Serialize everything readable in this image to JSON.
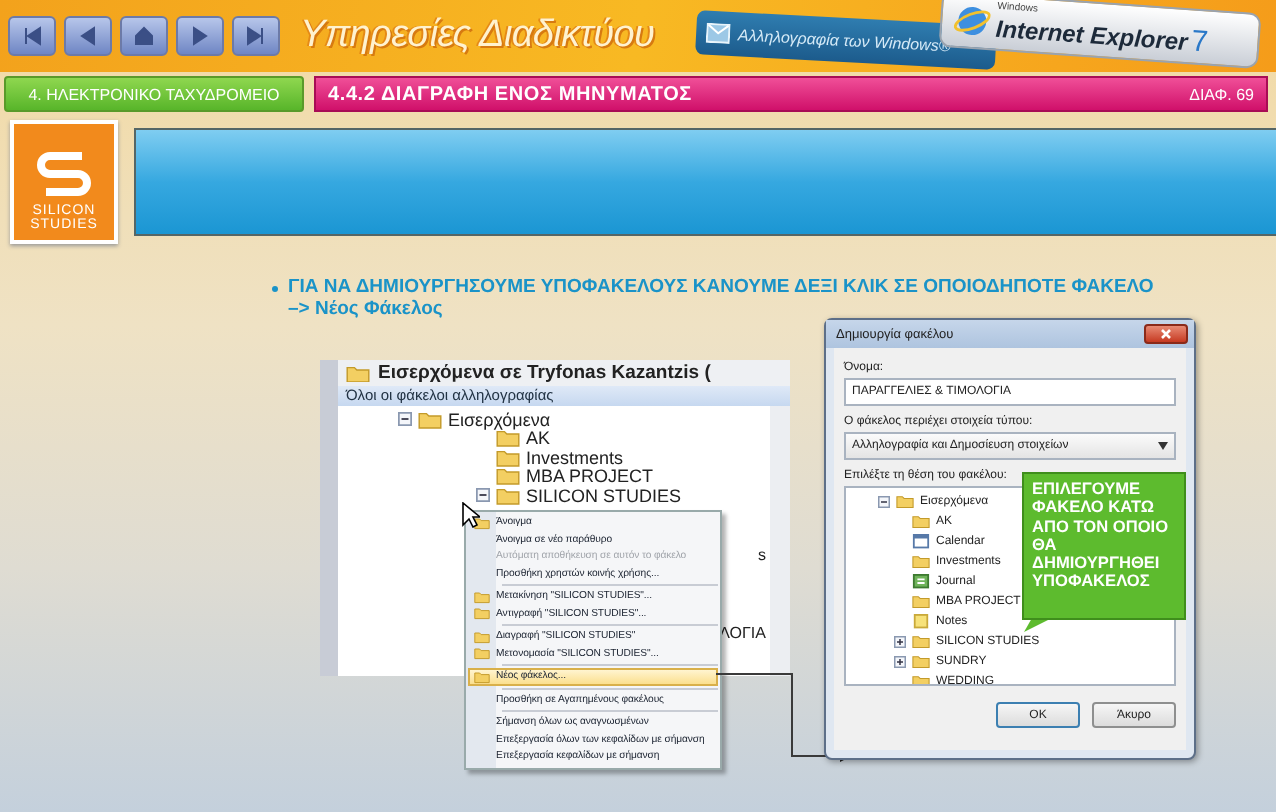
{
  "header": {
    "nav_buttons": [
      {
        "kind": "first"
      },
      {
        "kind": "prev"
      },
      {
        "kind": "home"
      },
      {
        "kind": "next"
      },
      {
        "kind": "last"
      }
    ],
    "title": "Υπηρεσίες Διαδικτύου",
    "badges": [
      {
        "kind": "mail",
        "text": "Αλληλογραφία των Windows®"
      },
      {
        "kind": "ie",
        "small": "Windows",
        "text": "Internet Explorer",
        "version": "7"
      }
    ]
  },
  "chapter_button": "4. ΗΛΕΚΤΡΟΝΙΚΟ ΤΑΧΥΔΡΟΜΕΙΟ",
  "section_title": "4.4.2 ΔΙΑΓΡΑΦΗ ΕΝΟΣ ΜΗΝΥΜΑΤΟΣ",
  "slide_number": "ΔΙΑΦ. 69",
  "logo": {
    "line1": "SILICON",
    "line2": "STUDIES"
  },
  "bullet": "ΓΙΑ ΝΑ ΔΗΜΙΟΥΡΓΗΣΟΥΜΕ ΥΠΟΦΑΚΕΛΟΥΣ ΚΑΝΟΥΜΕ ΔΕΞΙ ΚΛΙΚ ΣΕ ΟΠΟΙΟΔΗΠΟΤΕ ΦΑΚΕΛΟ –> Νέος Φάκελος",
  "mail_pane": {
    "title": "Εισερχόμενα σε Tryfonas Kazantzis (",
    "section": "Όλοι οι φάκελοι αλληλογραφίας",
    "folders": [
      {
        "name": "Εισερχόμενα",
        "expanded": true,
        "children": [
          {
            "name": "AK"
          },
          {
            "name": "Investments"
          },
          {
            "name": "MBA PROJECT"
          },
          {
            "name": "SILICON STUDIES",
            "expanded": true
          }
        ]
      }
    ],
    "partial_rows": [
      "s",
      "ΛΟΓΙΑ"
    ]
  },
  "context_menu": {
    "groups": [
      [
        {
          "label": "Άνοιγμα",
          "icon": true,
          "disabled": false,
          "selected": false
        },
        {
          "label": "Άνοιγμα σε νέο παράθυρο",
          "icon": false,
          "disabled": false,
          "selected": false
        },
        {
          "label": "Αυτόματη αποθήκευση σε αυτόν το φάκελο",
          "icon": false,
          "disabled": true,
          "selected": false
        },
        {
          "label": "Προσθήκη χρηστών κοινής χρήσης...",
          "icon": false,
          "disabled": false,
          "selected": false
        }
      ],
      [
        {
          "label": "Μετακίνηση \"SILICON STUDIES\"...",
          "icon": true,
          "disabled": false,
          "selected": false
        },
        {
          "label": "Αντιγραφή \"SILICON STUDIES\"...",
          "icon": true,
          "disabled": false,
          "selected": false
        }
      ],
      [
        {
          "label": "Διαγραφή \"SILICON STUDIES\"",
          "icon": true,
          "disabled": false,
          "selected": false
        },
        {
          "label": "Μετονομασία \"SILICON STUDIES\"...",
          "icon": true,
          "disabled": false,
          "selected": false
        }
      ],
      [
        {
          "label": "Νέος φάκελος...",
          "icon": true,
          "disabled": false,
          "selected": true
        }
      ],
      [
        {
          "label": "Προσθήκη σε Αγαπημένους φακέλους",
          "icon": false,
          "disabled": false,
          "selected": false
        }
      ],
      [
        {
          "label": "Σήμανση όλων ως αναγνωσμένων",
          "icon": false,
          "disabled": false,
          "selected": false
        },
        {
          "label": "Επεξεργασία όλων των κεφαλίδων με σήμανση",
          "icon": false,
          "disabled": false,
          "selected": false
        },
        {
          "label": "Επεξεργασία κεφαλίδων με σήμανση",
          "icon": false,
          "disabled": false,
          "selected": false
        }
      ]
    ]
  },
  "dialog": {
    "title": "Δημιουργία φακέλου",
    "name_label": "Όνομα:",
    "name_value": "ΠΑΡΑΓΓΕΛΙΕΣ & ΤΙΜΟΛΟΓΙΑ",
    "type_label": "Ο φάκελος περιέχει στοιχεία τύπου:",
    "type_value": "Αλληλογραφία και Δημοσίευση στοιχείων",
    "location_label": "Επιλέξτε τη θέση του φακέλου:",
    "folders": [
      {
        "name": "Εισερχόμενα",
        "expanded": true,
        "children": [
          {
            "name": "AK",
            "kind": "folder"
          },
          {
            "name": "Calendar",
            "kind": "calendar"
          },
          {
            "name": "Investments",
            "kind": "folder"
          },
          {
            "name": "Journal",
            "kind": "journal"
          },
          {
            "name": "MBA PROJECT",
            "kind": "folder"
          },
          {
            "name": "Notes",
            "kind": "notes"
          },
          {
            "name": "SILICON STUDIES",
            "kind": "folder",
            "expanded": false
          },
          {
            "name": "SUNDRY",
            "kind": "folder",
            "expanded": false
          },
          {
            "name": "WEDDING",
            "kind": "folder"
          }
        ]
      }
    ],
    "buttons": [
      "OK",
      "Άκυρο"
    ]
  },
  "callout": "ΕΠΙΛΕΓΟΥΜΕ ΦΑΚΕΛΟ ΚΑΤΩ ΑΠΟ ΤΟΝ ΟΠΟΙΟ ΘΑ ΔΗΜΙΟΥΡΓΗΘΕΙ ΥΠΟΦΑΚΕΛΟΣ"
}
